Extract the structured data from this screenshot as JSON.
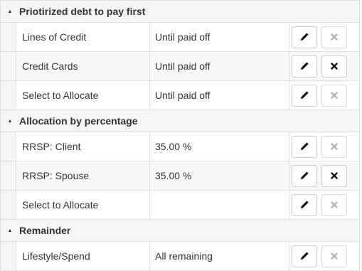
{
  "groups": [
    {
      "title": "Priotirized debt to pay first",
      "rows": [
        {
          "name": "Lines of Credit",
          "value": "Until paid off",
          "delete_enabled": false
        },
        {
          "name": "Credit Cards",
          "value": "Until paid off",
          "delete_enabled": true
        },
        {
          "name": "Select to Allocate",
          "value": "Until paid off",
          "delete_enabled": false
        }
      ]
    },
    {
      "title": "Allocation by percentage",
      "rows": [
        {
          "name": "RRSP: Client",
          "value": "35.00 %",
          "delete_enabled": false
        },
        {
          "name": "RRSP: Spouse",
          "value": "35.00 %",
          "delete_enabled": true
        },
        {
          "name": "Select to Allocate",
          "value": "",
          "delete_enabled": false
        }
      ]
    },
    {
      "title": "Remainder",
      "rows": [
        {
          "name": "Lifestyle/Spend",
          "value": "All remaining",
          "delete_enabled": false
        }
      ]
    }
  ],
  "icons": {
    "collapse": "triangle-down-icon",
    "edit": "pencil-icon",
    "delete": "x-icon"
  },
  "colors": {
    "icon_enabled": "#111111",
    "icon_disabled": "#b3b3b3",
    "header_bg": "#f5f5f5",
    "border": "#dddddd"
  }
}
